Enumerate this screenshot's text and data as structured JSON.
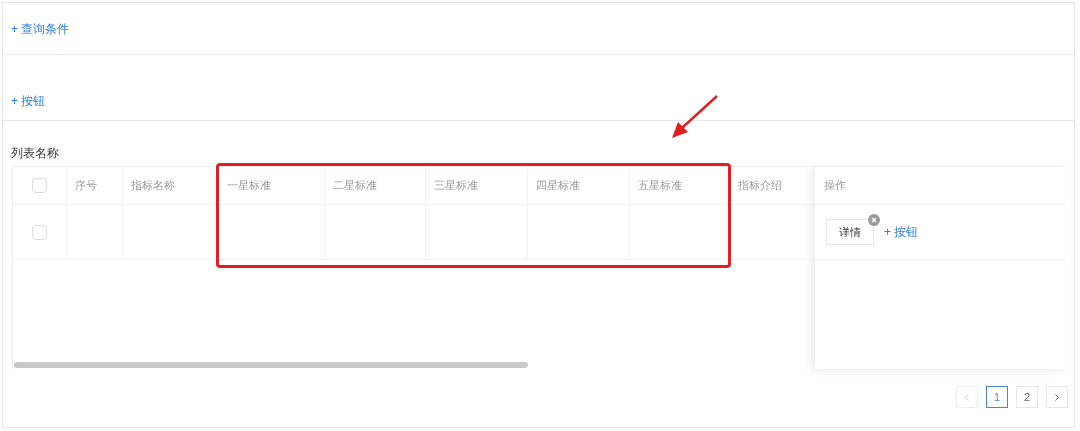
{
  "query_toggle": {
    "icon": "+",
    "label": "查询条件"
  },
  "toolbar_button": {
    "icon": "+",
    "label": "按钮"
  },
  "list": {
    "title": "列表名称",
    "select_all": {
      "checked": false
    },
    "columns": [
      "序号",
      "指标名称",
      "一星标准",
      "二星标准",
      "三星标准",
      "四星标准",
      "五星标准",
      "指标介绍"
    ],
    "action_column": "操作",
    "rows": [
      {
        "checked": false,
        "cells": [
          "",
          "",
          "",
          "",
          "",
          "",
          "",
          ""
        ],
        "actions": {
          "detail": "详情",
          "add_icon": "+",
          "add": "按钮"
        }
      }
    ]
  },
  "pagination": {
    "prev_disabled": true,
    "pages": [
      {
        "label": "1",
        "selected": true
      },
      {
        "label": "2",
        "selected": false
      }
    ]
  }
}
